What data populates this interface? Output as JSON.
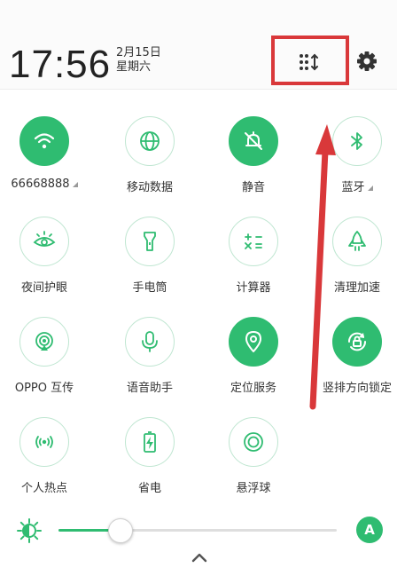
{
  "header": {
    "time": "17:56",
    "date": "2月15日",
    "weekday": "星期六",
    "edit_icon": "grid-sort-icon",
    "settings_icon": "gear-icon"
  },
  "tiles": [
    {
      "label": "66668888",
      "icon": "wifi-icon",
      "on": true,
      "caret": true
    },
    {
      "label": "移动数据",
      "icon": "globe-icon",
      "on": false,
      "caret": false
    },
    {
      "label": "静音",
      "icon": "bell-muted-icon",
      "on": true,
      "caret": false
    },
    {
      "label": "蓝牙",
      "icon": "bluetooth-icon",
      "on": false,
      "caret": true
    },
    {
      "label": "夜间护眼",
      "icon": "eye-sun-icon",
      "on": false,
      "caret": false
    },
    {
      "label": "手电筒",
      "icon": "flashlight-icon",
      "on": false,
      "caret": false
    },
    {
      "label": "计算器",
      "icon": "calculator-icon",
      "on": false,
      "caret": false
    },
    {
      "label": "清理加速",
      "icon": "rocket-icon",
      "on": false,
      "caret": false
    },
    {
      "label": "OPPO 互传",
      "icon": "share-icon",
      "on": false,
      "caret": false
    },
    {
      "label": "语音助手",
      "icon": "microphone-icon",
      "on": false,
      "caret": false
    },
    {
      "label": "定位服务",
      "icon": "location-icon",
      "on": true,
      "caret": false
    },
    {
      "label": "竖排方向锁定",
      "icon": "rotation-lock-icon",
      "on": true,
      "caret": false
    },
    {
      "label": "个人热点",
      "icon": "hotspot-icon",
      "on": false,
      "caret": false
    },
    {
      "label": "省电",
      "icon": "battery-icon",
      "on": false,
      "caret": false
    },
    {
      "label": "悬浮球",
      "icon": "floating-ball-icon",
      "on": false,
      "caret": false
    }
  ],
  "brightness": {
    "level": 0.22,
    "auto_label": "A",
    "icon": "brightness-icon"
  },
  "colors": {
    "accent": "#2fbc71",
    "highlight": "#d9383a"
  }
}
